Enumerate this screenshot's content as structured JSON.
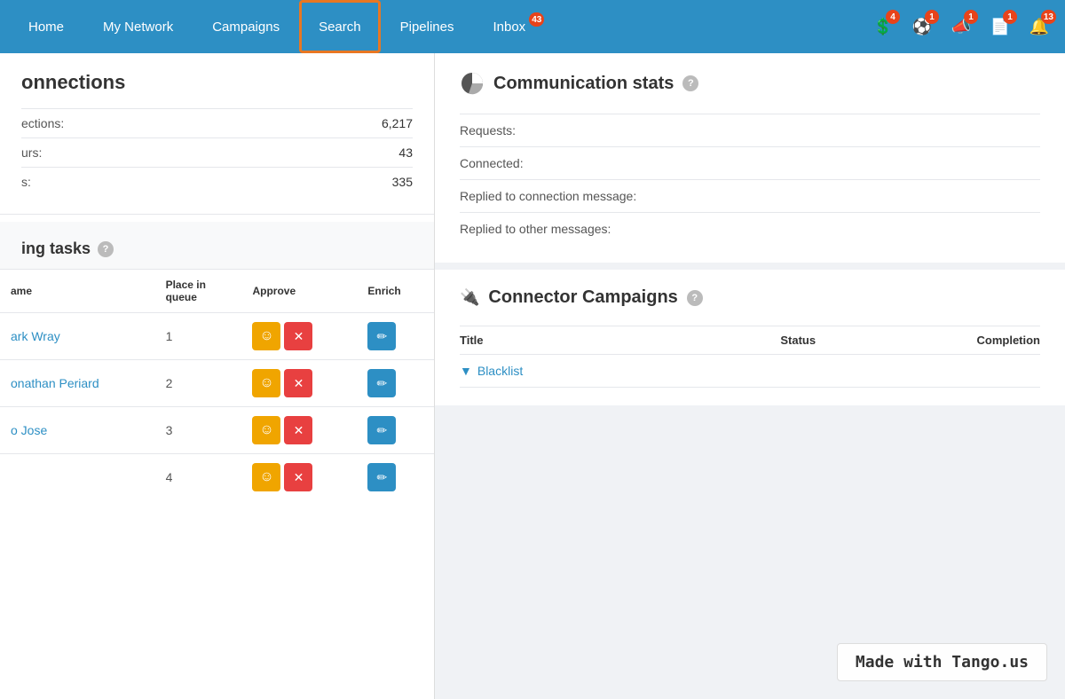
{
  "nav": {
    "items": [
      {
        "label": "Home",
        "id": "home",
        "active": false
      },
      {
        "label": "My Network",
        "id": "my-network",
        "active": false
      },
      {
        "label": "Campaigns",
        "id": "campaigns",
        "active": false
      },
      {
        "label": "Search",
        "id": "search",
        "active": true
      },
      {
        "label": "Pipelines",
        "id": "pipelines",
        "active": false
      },
      {
        "label": "Inbox",
        "id": "inbox",
        "active": false
      }
    ],
    "icons": [
      {
        "id": "dollar",
        "badge": "4",
        "badge_color": "orange",
        "symbol": "💲"
      },
      {
        "id": "globe",
        "badge": "1",
        "badge_color": "orange",
        "symbol": "⚽"
      },
      {
        "id": "megaphone",
        "badge": "1",
        "badge_color": "orange",
        "symbol": "📣"
      },
      {
        "id": "document",
        "badge": "1",
        "badge_color": "orange",
        "symbol": "📄"
      },
      {
        "id": "bell",
        "badge": "13",
        "badge_color": "orange",
        "symbol": "🔔"
      }
    ],
    "inbox_badge": "43"
  },
  "connections": {
    "title": "onnections",
    "rows": [
      {
        "label": "ections:",
        "value": "6,217"
      },
      {
        "label": "urs:",
        "value": "43"
      },
      {
        "label": "s:",
        "value": "335"
      }
    ]
  },
  "pending_tasks": {
    "title": "ing tasks",
    "columns": [
      "ame",
      "Place in queue",
      "Approve",
      "Enrich"
    ],
    "rows": [
      {
        "name": "ark Wray",
        "queue": "1"
      },
      {
        "name": "onathan Periard",
        "queue": "2"
      },
      {
        "name": "o Jose",
        "queue": "3"
      },
      {
        "name": "",
        "queue": "4"
      }
    ]
  },
  "communication_stats": {
    "title": "Communication stats",
    "rows": [
      {
        "label": "Requests:"
      },
      {
        "label": "Connected:"
      },
      {
        "label": "Replied to connection message:"
      },
      {
        "label": "Replied to other messages:"
      }
    ]
  },
  "connector_campaigns": {
    "title": "Connector Campaigns",
    "columns": [
      "Title",
      "Status",
      "Completion"
    ],
    "rows": [
      {
        "title": "Blacklist"
      }
    ]
  },
  "watermark": "Made with Tango.us"
}
